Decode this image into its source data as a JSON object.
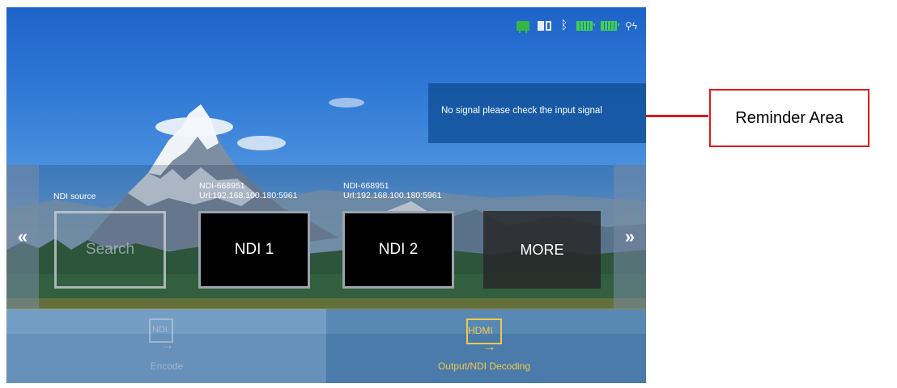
{
  "status_bar": {
    "icons": [
      "ethernet-icon",
      "sd-card-icon",
      "bluetooth-icon",
      "battery-icon",
      "battery-icon",
      "power-plug-icon"
    ],
    "accent_color": "#33b844"
  },
  "reminder": {
    "message": "No signal please check the input signal"
  },
  "ndi": {
    "source_label": "NDI source",
    "slot1": {
      "name": "NDI-668951",
      "url": "Url:192.168.100.180:5961",
      "tile": "NDI 1"
    },
    "slot2": {
      "name": "NDI-668951",
      "url": "Url:192.168.100.180:5961",
      "tile": "NDI 2"
    },
    "search_label": "Search",
    "more_label": "MORE",
    "nav_left_icon": "chevron-left-icon",
    "nav_right_icon": "chevron-right-icon"
  },
  "modes": {
    "encode": {
      "tag": "NDI",
      "label": "Encode",
      "active": false
    },
    "decode": {
      "tag": "HDMI",
      "label": "Output/NDI Decoding",
      "active": true,
      "accent": "#f2c84b"
    }
  },
  "annotation": {
    "label": "Reminder Area",
    "color": "#e11919"
  }
}
